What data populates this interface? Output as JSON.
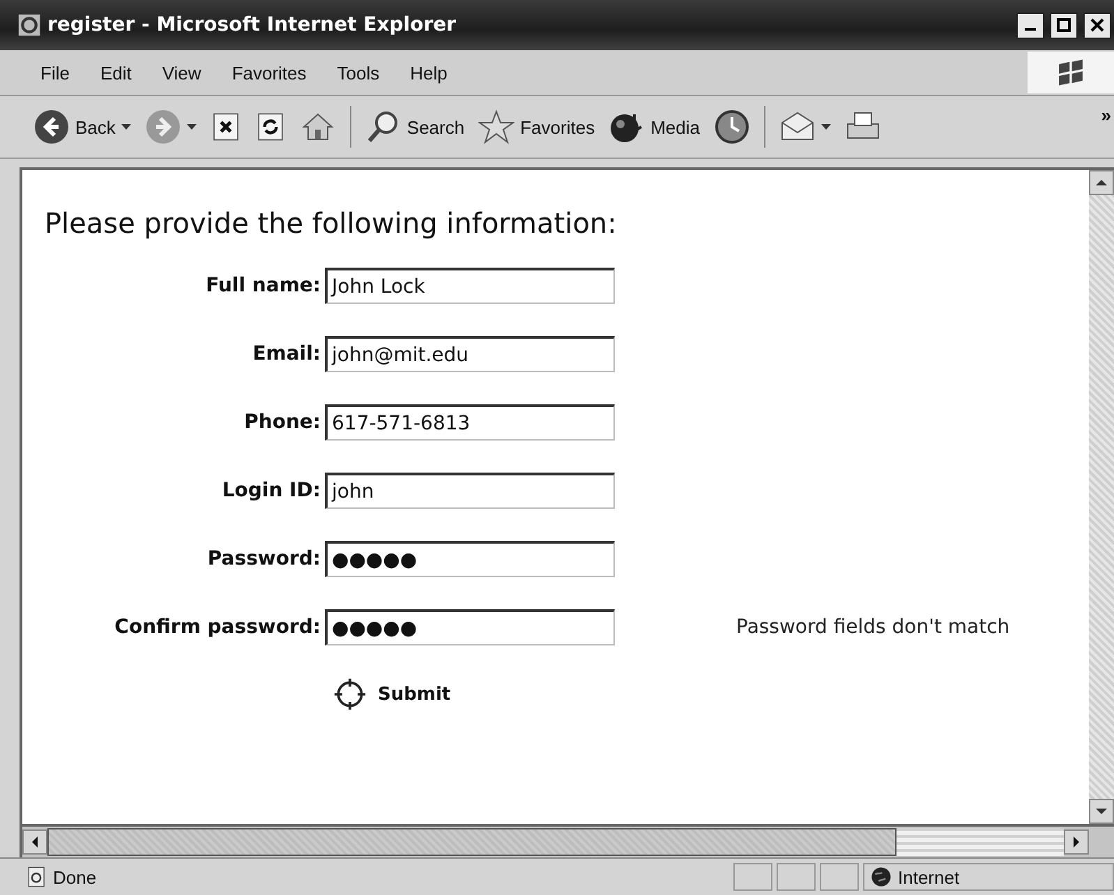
{
  "window": {
    "title": "register - Microsoft Internet Explorer"
  },
  "menu": [
    "File",
    "Edit",
    "View",
    "Favorites",
    "Tools",
    "Help"
  ],
  "toolbar": [
    {
      "kind": "back",
      "label": "Back"
    },
    {
      "kind": "forward"
    },
    {
      "kind": "stop"
    },
    {
      "kind": "refresh"
    },
    {
      "kind": "home"
    },
    {
      "kind": "search",
      "label": "Search"
    },
    {
      "kind": "favorites",
      "label": "Favorites"
    },
    {
      "kind": "media",
      "label": "Media"
    },
    {
      "kind": "history"
    },
    {
      "kind": "mail"
    },
    {
      "kind": "print"
    },
    {
      "kind": "more",
      "label": "»"
    }
  ],
  "page": {
    "heading": "Please provide the following information:",
    "fields": [
      {
        "label": "Full name:",
        "value": "John Lock"
      },
      {
        "label": "Email:",
        "value": "john@mit.edu"
      },
      {
        "label": "Phone:",
        "value": "617-571-6813"
      },
      {
        "label": "Login ID:",
        "value": "john"
      },
      {
        "label": "Password:",
        "value": "●●●●●"
      },
      {
        "label": "Confirm password:",
        "value": "●●●●●",
        "message": "Password fields don't match"
      }
    ],
    "submit": "Submit"
  },
  "status_bar": {
    "text": "Done",
    "zone": "Internet"
  }
}
